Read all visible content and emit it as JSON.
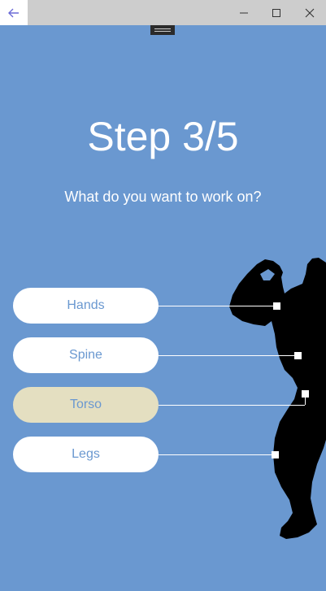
{
  "window": {
    "back_icon": "arrow-left-icon",
    "minimize_icon": "minimize-icon",
    "maximize_icon": "maximize-icon",
    "close_icon": "close-icon"
  },
  "colors": {
    "background": "#6a98d0",
    "option_bg": "#ffffff",
    "option_selected_bg": "#e4dfc1",
    "option_text": "#6a98d0",
    "silhouette": "#000000"
  },
  "step_title": "Step 3/5",
  "question": "What do you want to work on?",
  "options": [
    {
      "label": "Hands",
      "selected": false
    },
    {
      "label": "Spine",
      "selected": false
    },
    {
      "label": "Torso",
      "selected": true
    },
    {
      "label": "Legs",
      "selected": false
    }
  ]
}
